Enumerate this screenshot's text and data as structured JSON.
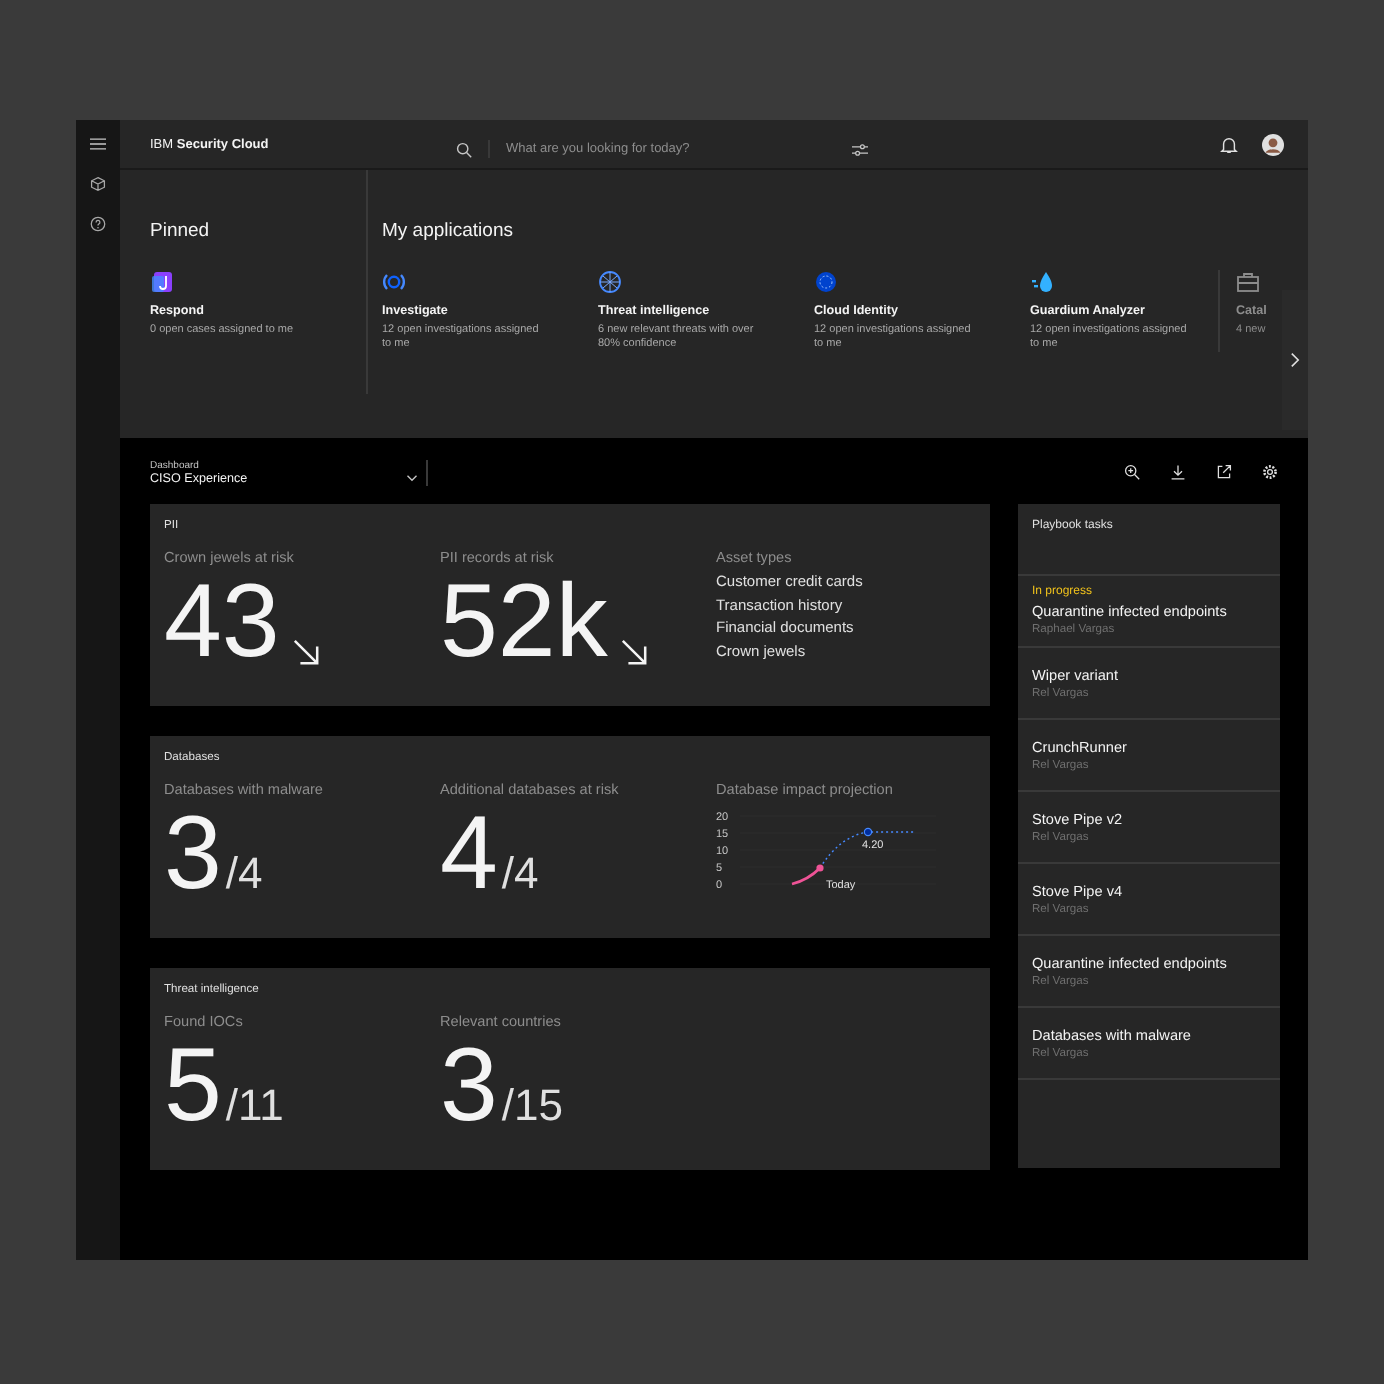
{
  "header": {
    "brand": "IBM **Security Cloud**",
    "search": {
      "placeholder": "What are you looking for today?"
    }
  },
  "launcher": {
    "pinned": {
      "title": "Pinned",
      "apps": [
        {
          "name": "Respond",
          "description": "0 open cases assigned to me"
        }
      ]
    },
    "applications": {
      "title": "My applications",
      "apps": [
        {
          "name": "Investigate",
          "description": "12 open investigations assigned to me"
        },
        {
          "name": "Threat intelligence",
          "description": "6 new relevant threats with over 80% confidence"
        },
        {
          "name": "Cloud Identity",
          "description": "12 open investigations assigned to me"
        },
        {
          "name": "Guardium Analyzer",
          "description": "12 open investigations assigned to me"
        },
        {
          "name": "Catal",
          "description": "4 new"
        }
      ]
    }
  },
  "dashboard": {
    "label": "Dashboard",
    "value": "CISO Experience"
  },
  "panels": [
    {
      "title": "PII",
      "metrics": [
        {
          "label": "Crown jewels at risk",
          "value": "43",
          "trending_down": true
        },
        {
          "label": "PII records at risk",
          "value": "52k",
          "trending_down": true
        }
      ],
      "extra": {
        "kind": "list",
        "title": "Asset types",
        "items": [
          "Customer credit cards",
          "Transaction history",
          "Financial documents",
          "Crown jewels"
        ]
      }
    },
    {
      "title": "Databases",
      "metrics": [
        {
          "label": "Databases with malware",
          "value": "3",
          "total": "/4"
        },
        {
          "label": "Additional databases at risk",
          "value": "4",
          "total": "/4"
        }
      ],
      "extra": {
        "kind": "chart",
        "title": "Database impact projection",
        "tick_labels": [
          "20",
          "15",
          "10",
          "5",
          "0"
        ],
        "point_labels": [
          "Today",
          "4.20"
        ]
      }
    },
    {
      "title": "Threat intelligence",
      "metrics": [
        {
          "label": "Found IOCs",
          "value": "5",
          "total": "/11"
        },
        {
          "label": "Relevant countries",
          "value": "3",
          "total": "/15"
        }
      ]
    }
  ],
  "playbook": {
    "title": "Playbook tasks",
    "tasks": [
      {
        "status": "In progress",
        "title": "Quarantine infected endpoints",
        "owner": "Raphael Vargas"
      },
      {
        "title": "Wiper variant",
        "owner": "Rel Vargas"
      },
      {
        "title": "CrunchRunner",
        "owner": "Rel Vargas"
      },
      {
        "title": "Stove Pipe v2",
        "owner": "Rel Vargas"
      },
      {
        "title": "Stove Pipe v4",
        "owner": "Rel Vargas"
      },
      {
        "title": "Quarantine infected endpoints",
        "owner": "Rel Vargas"
      },
      {
        "title": "Databases with malware",
        "owner": "Rel Vargas"
      }
    ]
  }
}
